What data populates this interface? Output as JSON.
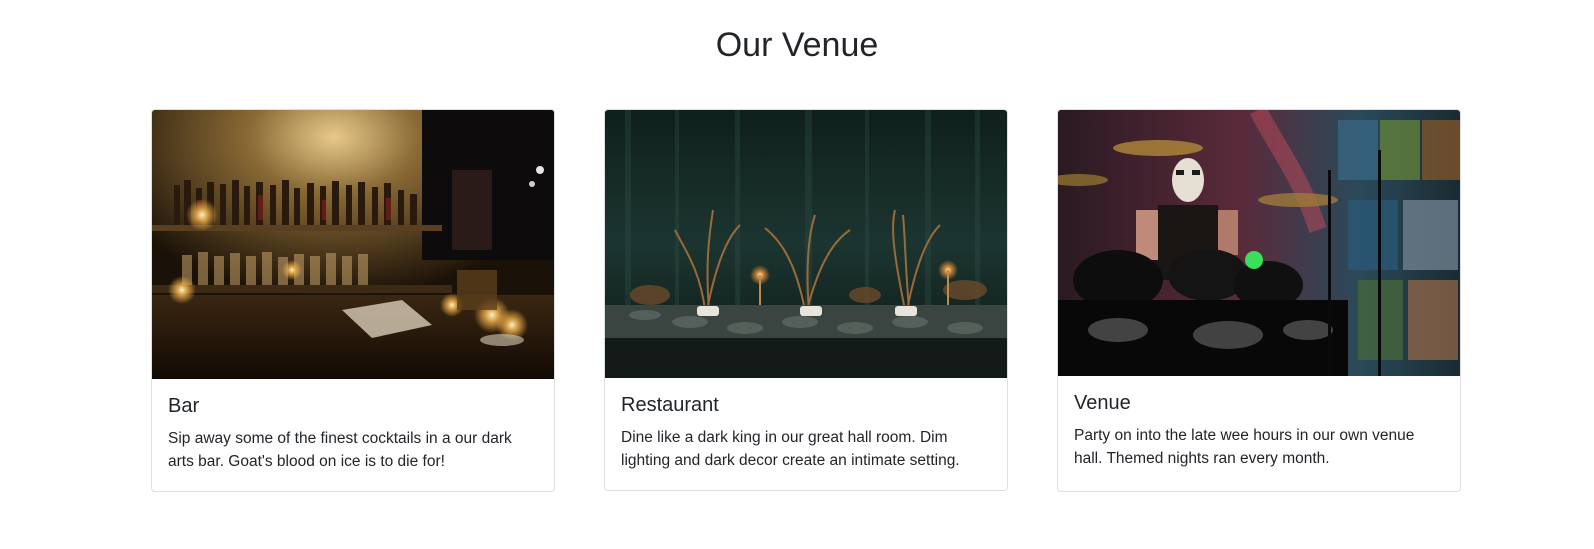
{
  "section": {
    "title": "Our Venue"
  },
  "cards": [
    {
      "image_alt": "Bar interior with shelves of bottles and candles",
      "title": "Bar",
      "text": "Sip away some of the finest cocktails in a our dark arts bar. Goat's blood on ice is to die for!"
    },
    {
      "image_alt": "Long dining table with candles and dried plants against a dark wall",
      "title": "Restaurant",
      "text": "Dine like a dark king in our great hall room. Dim lighting and dark decor create an intimate setting."
    },
    {
      "image_alt": "Drummer in face paint performing on stage with stained glass backdrop",
      "title": "Venue",
      "text": "Party on into the late wee hours in our own venue hall. Themed nights ran every month."
    }
  ],
  "colors": {
    "text": "#212529",
    "card_border": "#dcdfe3",
    "background": "#ffffff"
  }
}
